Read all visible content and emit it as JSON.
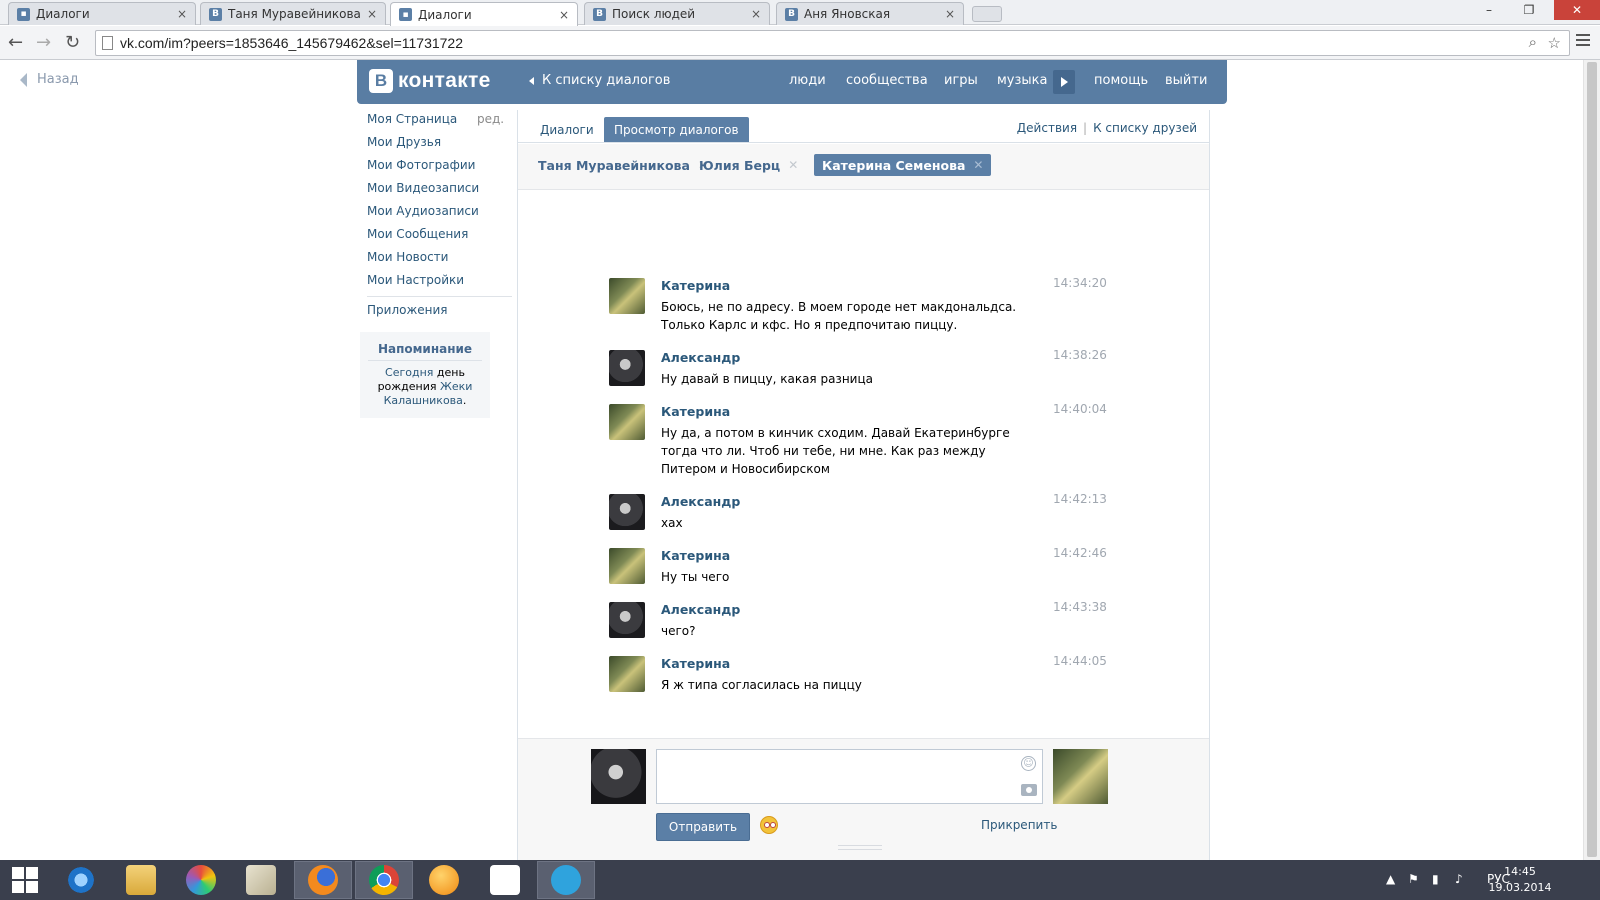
{
  "browser": {
    "tabs": [
      {
        "title": "Диалоги",
        "icon": "chat-icon",
        "active": false
      },
      {
        "title": "Таня Муравейникова",
        "icon": "vk-icon",
        "active": false
      },
      {
        "title": "Диалоги",
        "icon": "chat-icon",
        "active": true
      },
      {
        "title": "Поиск людей",
        "icon": "vk-icon",
        "active": false
      },
      {
        "title": "Аня Яновская",
        "icon": "vk-icon",
        "active": false
      }
    ],
    "tab_close": "×",
    "url": "vk.com/im?peers=1853646_145679462&sel=11731722"
  },
  "page": {
    "back_label": "Назад",
    "header": {
      "logo_letter": "В",
      "logo_word": "контакте",
      "back_to_dialogs": "К списку диалогов",
      "nav": [
        "люди",
        "сообщества",
        "игры",
        "музыка",
        "помощь",
        "выйти"
      ]
    },
    "left_menu": {
      "edit": "ред.",
      "items": [
        "Моя Страница",
        "Мои Друзья",
        "Мои Фотографии",
        "Мои Видеозаписи",
        "Мои Аудиозаписи",
        "Мои Сообщения",
        "Мои Новости",
        "Мои Настройки"
      ],
      "apps": "Приложения",
      "reminder": {
        "title": "Напоминание",
        "today": "Сегодня",
        "birthday_text": " день рождения ",
        "person": "Жеки Калашникова",
        "end": "."
      }
    },
    "tabs": {
      "dialogs": "Диалоги",
      "view_dialogs": "Просмотр диалогов",
      "actions": "Действия",
      "separator": "|",
      "to_friends": "К списку друзей"
    },
    "peers": [
      {
        "name": "Таня Муравейникова",
        "active": false
      },
      {
        "name": "Юлия Берц",
        "active": false
      },
      {
        "name": "Катерина Семенова",
        "active": true
      }
    ],
    "messages": [
      {
        "author": "Катерина",
        "time": "14:34:20",
        "text": "Боюсь, не по адресу. В моем городе нет макдональдса. Только Карлс и кфс. Но я предпочитаю пиццу."
      },
      {
        "author": "Александр",
        "time": "14:38:26",
        "text": "Ну давай в пиццу, какая разница"
      },
      {
        "author": "Катерина",
        "time": "14:40:04",
        "text": "Ну да, а потом в кинчик сходим. Давай Екатеринбурге тогда что ли. Чтоб ни тебе, ни мне. Как раз между Питером и Новосибирском"
      },
      {
        "author": "Александр",
        "time": "14:42:13",
        "text": "хах"
      },
      {
        "author": "Катерина",
        "time": "14:42:46",
        "text": "Ну ты чего"
      },
      {
        "author": "Александр",
        "time": "14:43:38",
        "text": "чего?"
      },
      {
        "author": "Катерина",
        "time": "14:44:05",
        "text": "Я ж типа согласилась на пиццу"
      }
    ],
    "composer": {
      "send": "Отправить",
      "attach": "Прикрепить",
      "message_value": ""
    }
  },
  "taskbar": {
    "apps": [
      "windows-start-icon",
      "internet-explorer-icon",
      "file-explorer-icon",
      "picasa-icon",
      "notepad-icon",
      "firefox-icon",
      "chrome-icon",
      "orange-app-icon",
      "apps-grid-icon",
      "telegram-icon"
    ],
    "language": "РУС",
    "time": "14:45",
    "date": "19.03.2014"
  }
}
